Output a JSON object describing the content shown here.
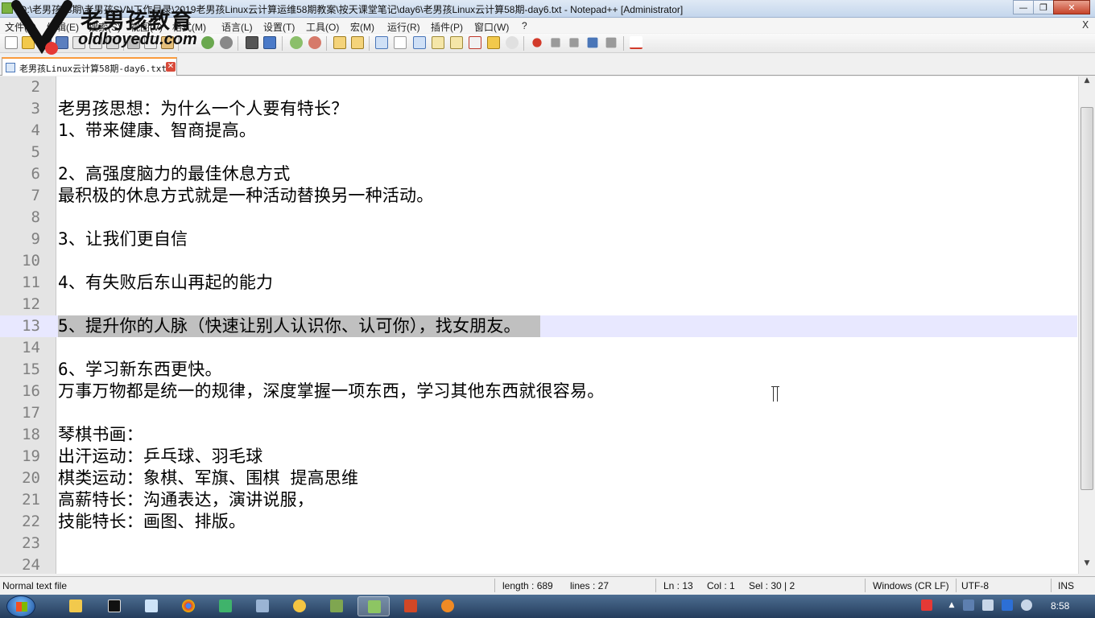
{
  "window": {
    "title": "*D:\\老男孩58期\\老男孩SVN工作目录\\2019老男孩Linux云计算运维58期教案\\按天课堂笔记\\day6\\老男孩Linux云计算58期-day6.txt - Notepad++ [Administrator]",
    "min_label": "—",
    "max_label": "❐",
    "close_label": "✕"
  },
  "menu": {
    "items": [
      "文件(F)",
      "编辑(E)",
      "搜索(S)",
      "视图(V)",
      "格式(M)",
      "语言(L)",
      "设置(T)",
      "工具(O)",
      "宏(M)",
      "运行(R)",
      "插件(P)",
      "窗口(W)",
      "?"
    ],
    "close_doc": "X"
  },
  "toolbar": {
    "icons": [
      "new-file-icon",
      "open-file-icon",
      "save-icon",
      "save-all-icon",
      "close-icon",
      "close-all-icon",
      "print-icon",
      "cut-icon",
      "copy-icon",
      "paste-icon",
      "undo-icon",
      "redo-icon",
      "find-icon",
      "replace-icon",
      "zoom-in-icon",
      "zoom-out-icon",
      "sync-v-icon",
      "sync-h-icon",
      "word-wrap-icon",
      "show-all-chars-icon",
      "indent-guide-icon",
      "udl-icon",
      "doc-map-icon",
      "function-list-icon",
      "folder-workspace-icon",
      "monitoring-icon",
      "record-macro-icon",
      "stop-record-icon",
      "play-macro-icon",
      "run-macro-multiple-icon",
      "save-macro-icon",
      "spell-check-icon"
    ]
  },
  "tabs": [
    {
      "label": "老男孩Linux云计算58期-day6.txt",
      "close": "✕"
    }
  ],
  "editor": {
    "current_line": 13,
    "lines": [
      {
        "n": "2",
        "text": ""
      },
      {
        "n": "3",
        "text": "老男孩思想：为什么一个人要有特长？"
      },
      {
        "n": "4",
        "text": "1、带来健康、智商提高。"
      },
      {
        "n": "5",
        "text": ""
      },
      {
        "n": "6",
        "text": "2、高强度脑力的最佳休息方式"
      },
      {
        "n": "7",
        "text": "最积极的休息方式就是一种活动替换另一种活动。"
      },
      {
        "n": "8",
        "text": ""
      },
      {
        "n": "9",
        "text": "3、让我们更自信"
      },
      {
        "n": "10",
        "text": ""
      },
      {
        "n": "11",
        "text": "4、有失败后东山再起的能力"
      },
      {
        "n": "12",
        "text": ""
      },
      {
        "n": "13",
        "text": "5、提升你的人脉（快速让别人认识你、认可你），找女朋友。"
      },
      {
        "n": "14",
        "text": ""
      },
      {
        "n": "15",
        "text": "6、学习新东西更快。"
      },
      {
        "n": "16",
        "text": "万事万物都是统一的规律，深度掌握一项东西，学习其他东西就很容易。"
      },
      {
        "n": "17",
        "text": ""
      },
      {
        "n": "18",
        "text": "琴棋书画："
      },
      {
        "n": "19",
        "text": "出汗运动：乒乓球、羽毛球"
      },
      {
        "n": "20",
        "text": "棋类运动：象棋、军旗、围棋 提高思维"
      },
      {
        "n": "21",
        "text": "高薪特长：沟通表达，演讲说服，"
      },
      {
        "n": "22",
        "text": "技能特长：画图、排版。"
      },
      {
        "n": "23",
        "text": ""
      },
      {
        "n": "24",
        "text": ""
      }
    ]
  },
  "scrollbar": {
    "up": "▲",
    "down": "▼"
  },
  "statusbar": {
    "file_type": "Normal text file",
    "length": "length : 689",
    "lines": "lines : 27",
    "ln": "Ln : 13",
    "col": "Col : 1",
    "sel": "Sel : 30 | 2",
    "eol": "Windows (CR LF)",
    "encoding": "UTF-8",
    "mode": "INS"
  },
  "taskbar": {
    "apps": [
      "explorer-icon",
      "pycharm-icon",
      "notepad-icon",
      "chrome-icon",
      "app-green-icon",
      "app-network-icon",
      "paint-icon",
      "app-flag-icon",
      "notepadpp-icon",
      "powerpoint-icon",
      "app-orange-icon"
    ],
    "clock": "8:58"
  },
  "watermark": {
    "title": "老男孩教育",
    "domain": "oldboyedu.com"
  }
}
